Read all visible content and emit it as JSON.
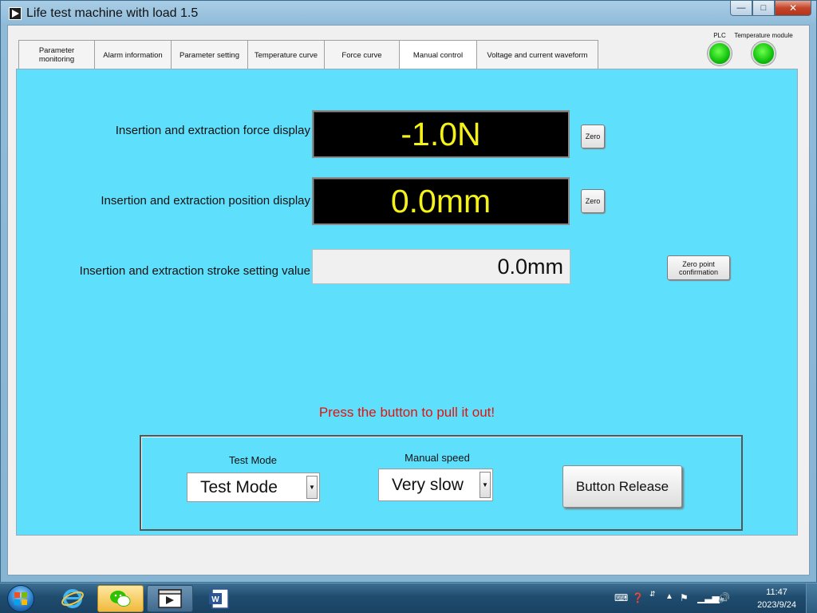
{
  "window": {
    "title": "Life test machine with load 1.5",
    "controls": {
      "minimize": "—",
      "maximize": "□",
      "close": "✕"
    }
  },
  "tabs": [
    {
      "label": "Parameter monitoring",
      "active": false
    },
    {
      "label": "Alarm information",
      "active": false
    },
    {
      "label": "Parameter setting",
      "active": false
    },
    {
      "label": "Temperature curve",
      "active": false
    },
    {
      "label": "Force curve",
      "active": false
    },
    {
      "label": "Manual control",
      "active": true
    },
    {
      "label": "Voltage and current waveform",
      "active": false
    }
  ],
  "indicators": {
    "plc": {
      "label": "PLC",
      "color": "#1ecb14"
    },
    "temperature_module": {
      "label": "Temperature module",
      "color": "#1ecb14"
    }
  },
  "manual_control": {
    "background_color": "#5ee0fd",
    "force": {
      "label": "Insertion and extraction force display",
      "value": "-1.0N",
      "zero_button": "Zero"
    },
    "position": {
      "label": "Insertion and extraction position display",
      "value": "0.0mm",
      "zero_button": "Zero"
    },
    "stroke": {
      "label": "Insertion and extraction stroke setting value",
      "value": "0.0mm",
      "zero_confirm_line1": "Zero point",
      "zero_confirm_line2": "confirmation"
    },
    "instruction": "Press the button to pull it out!",
    "instruction_color": "#e0140f",
    "test_mode": {
      "label": "Test Mode",
      "selected": "Test Mode"
    },
    "manual_speed": {
      "label": "Manual speed",
      "selected": "Very slow"
    },
    "release_button": "Button Release"
  },
  "taskbar": {
    "items": [
      "start-orb",
      "internet-explorer-icon",
      "wechat-icon",
      "app-window-icon",
      "word-icon"
    ],
    "clock_time": "11:47",
    "clock_date": "2023/9/24"
  }
}
